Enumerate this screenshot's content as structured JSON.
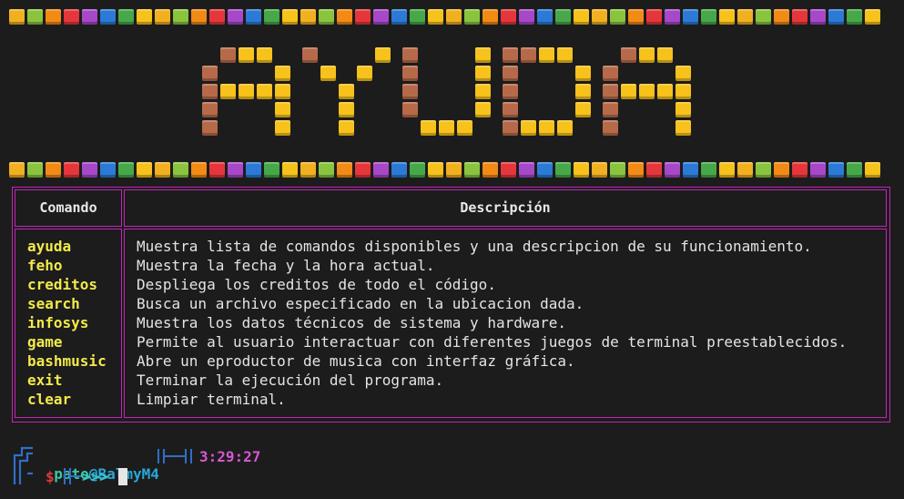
{
  "banner": {
    "word": "AYUDA"
  },
  "colors": {
    "blocks": [
      "#f0b020",
      "#8ac43f",
      "#f28a16",
      "#e5373b",
      "#a648c8",
      "#2c7ad6",
      "#47a84a",
      "#f6c21b"
    ],
    "tile_main": "#f6c21b",
    "tile_shadow": "#b76a4a",
    "border": "#c026b7",
    "command": "#f2e94a",
    "user": "#3cc6a6",
    "host": "#2aa7d8",
    "clock": "#d657d0",
    "prompt_symbol": "#e5373b",
    "arrows": "#3cc6c6"
  },
  "table": {
    "header_command": "Comando",
    "header_description": "Descripción",
    "rows": [
      {
        "command": "ayuda",
        "description": "Muestra lista de comandos disponibles y una descripcion de su funcionamiento."
      },
      {
        "command": "feho",
        "description": "Muestra la fecha y la hora actual."
      },
      {
        "command": "creditos",
        "description": "Despliega los creditos de todo el código."
      },
      {
        "command": "search",
        "description": "Busca un archivo especificado en la ubicacion dada."
      },
      {
        "command": "infosys",
        "description": "Muestra los datos técnicos de sistema y hardware."
      },
      {
        "command": "game",
        "description": "Permite al usuario interactuar con diferentes juegos de terminal preestablecidos."
      },
      {
        "command": "bashmusic",
        "description": "Abre un eproductor de musica con interfaz gráfica."
      },
      {
        "command": "exit",
        "description": "Terminar la ejecución del programa."
      },
      {
        "command": "clear",
        "description": "Limpiar terminal."
      }
    ]
  },
  "prompt": {
    "user": "pato",
    "at": "@",
    "host": "BalmyM4",
    "time": "3:29:27",
    "symbol": "$",
    "arrows": ">>>"
  }
}
